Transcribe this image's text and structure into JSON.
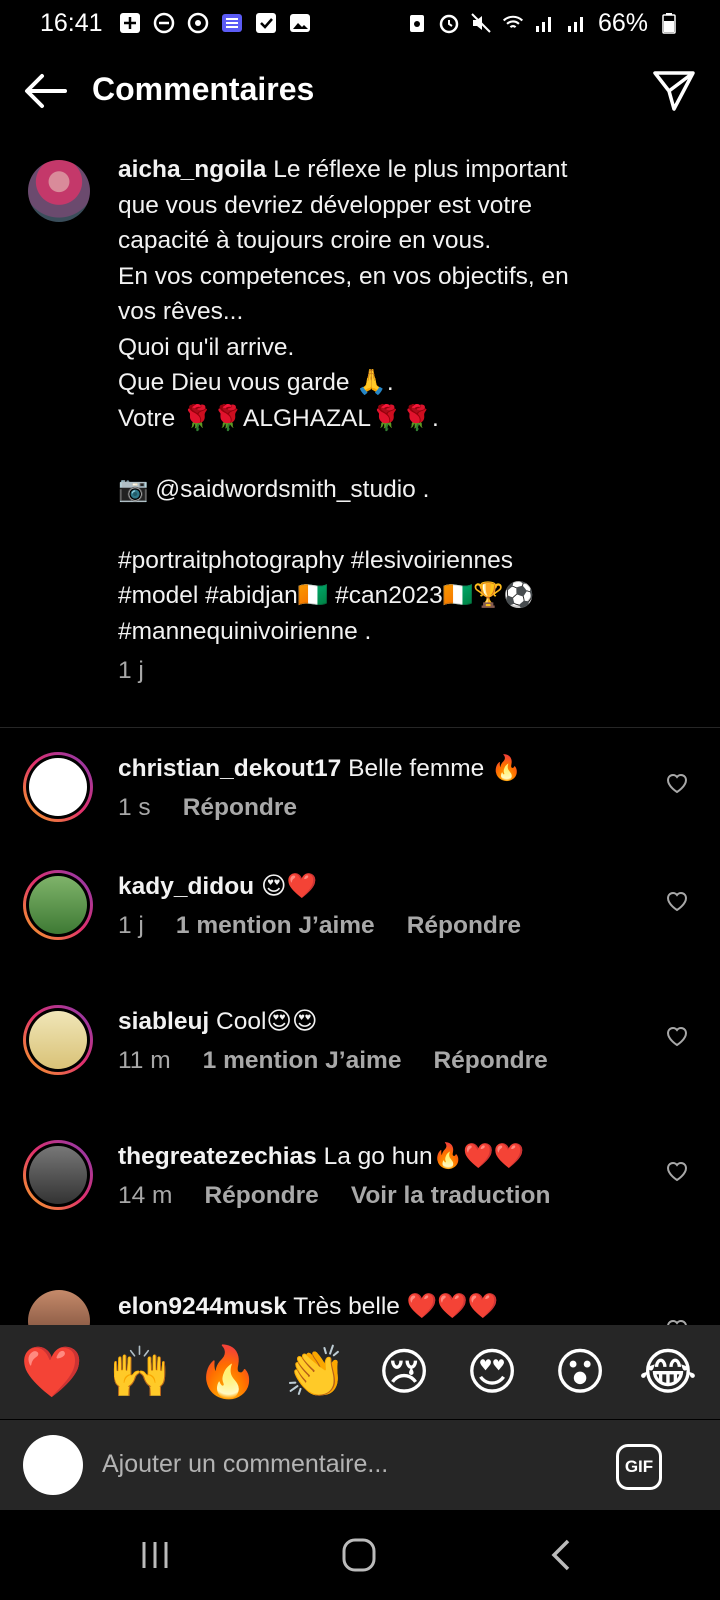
{
  "status_bar": {
    "time": "16:41",
    "battery": "66%",
    "left_icons": [
      "plus-square-icon",
      "minus-circle-icon",
      "settings-icon",
      "checklist-icon",
      "checkbox-icon",
      "image-icon"
    ],
    "right_icons": [
      "lock-battery-icon",
      "alarm-icon",
      "mute-icon",
      "wifi-icon",
      "signal-icon",
      "signal-icon",
      "battery-icon"
    ]
  },
  "header": {
    "title": "Commentaires",
    "back_icon": "arrow-left-icon",
    "send_icon": "send-icon"
  },
  "caption": {
    "username": "aicha_ngoila",
    "lines": [
      " Le réflexe le plus important",
      "que vous devriez développer est votre",
      "capacité à toujours croire en vous.",
      "En vos competences, en vos objectifs, en",
      "vos rêves...",
      "Quoi qu'il arrive.",
      "Que Dieu vous garde 🙏.",
      "Votre 🌹🌹ALGHAZAL🌹🌹.",
      "",
      "📷 @saidwordsmith_studio .",
      "",
      "#portraitphotography #lesivoiriennes",
      "#model #abidjan🇨🇮 #can2023🇨🇮🏆⚽",
      "#mannequinivoirienne ."
    ],
    "age": "1 j"
  },
  "comments": [
    {
      "username": "christian_dekout17",
      "text": " Belle femme 🔥",
      "age": "1 s",
      "likes": "",
      "reply": "Répondre",
      "extra": ""
    },
    {
      "username": "kady_didou",
      "text": " 😍❤️",
      "age": "1 j",
      "likes": "1 mention J’aime",
      "reply": "Répondre",
      "extra": ""
    },
    {
      "username": "siableuj",
      "text": " Cool😍😍",
      "age": "11 m",
      "likes": "1 mention J’aime",
      "reply": "Répondre",
      "extra": ""
    },
    {
      "username": "thegreatezechias",
      "text": " La go hun🔥❤️❤️",
      "age": "14 m",
      "likes": "",
      "reply": "Répondre",
      "extra": "Voir la traduction"
    },
    {
      "username": "elon9244musk",
      "text": " Très belle ❤️❤️❤️",
      "age": "",
      "likes": "",
      "reply": "",
      "extra": ""
    }
  ],
  "reactions": [
    "❤️",
    "🙌",
    "🔥",
    "👏",
    "😢",
    "😍",
    "😮",
    "😂"
  ],
  "composer": {
    "placeholder": "Ajouter un commentaire...",
    "gif_label": "GIF"
  },
  "navbar": {
    "icons": [
      "recent-apps-icon",
      "home-icon",
      "back-icon"
    ]
  },
  "colors": {
    "background": "#000000",
    "panel": "#262626",
    "secondary_text": "#a8a8a8",
    "story_ring_start": "#f9a825",
    "story_ring_end": "#833ab4"
  }
}
